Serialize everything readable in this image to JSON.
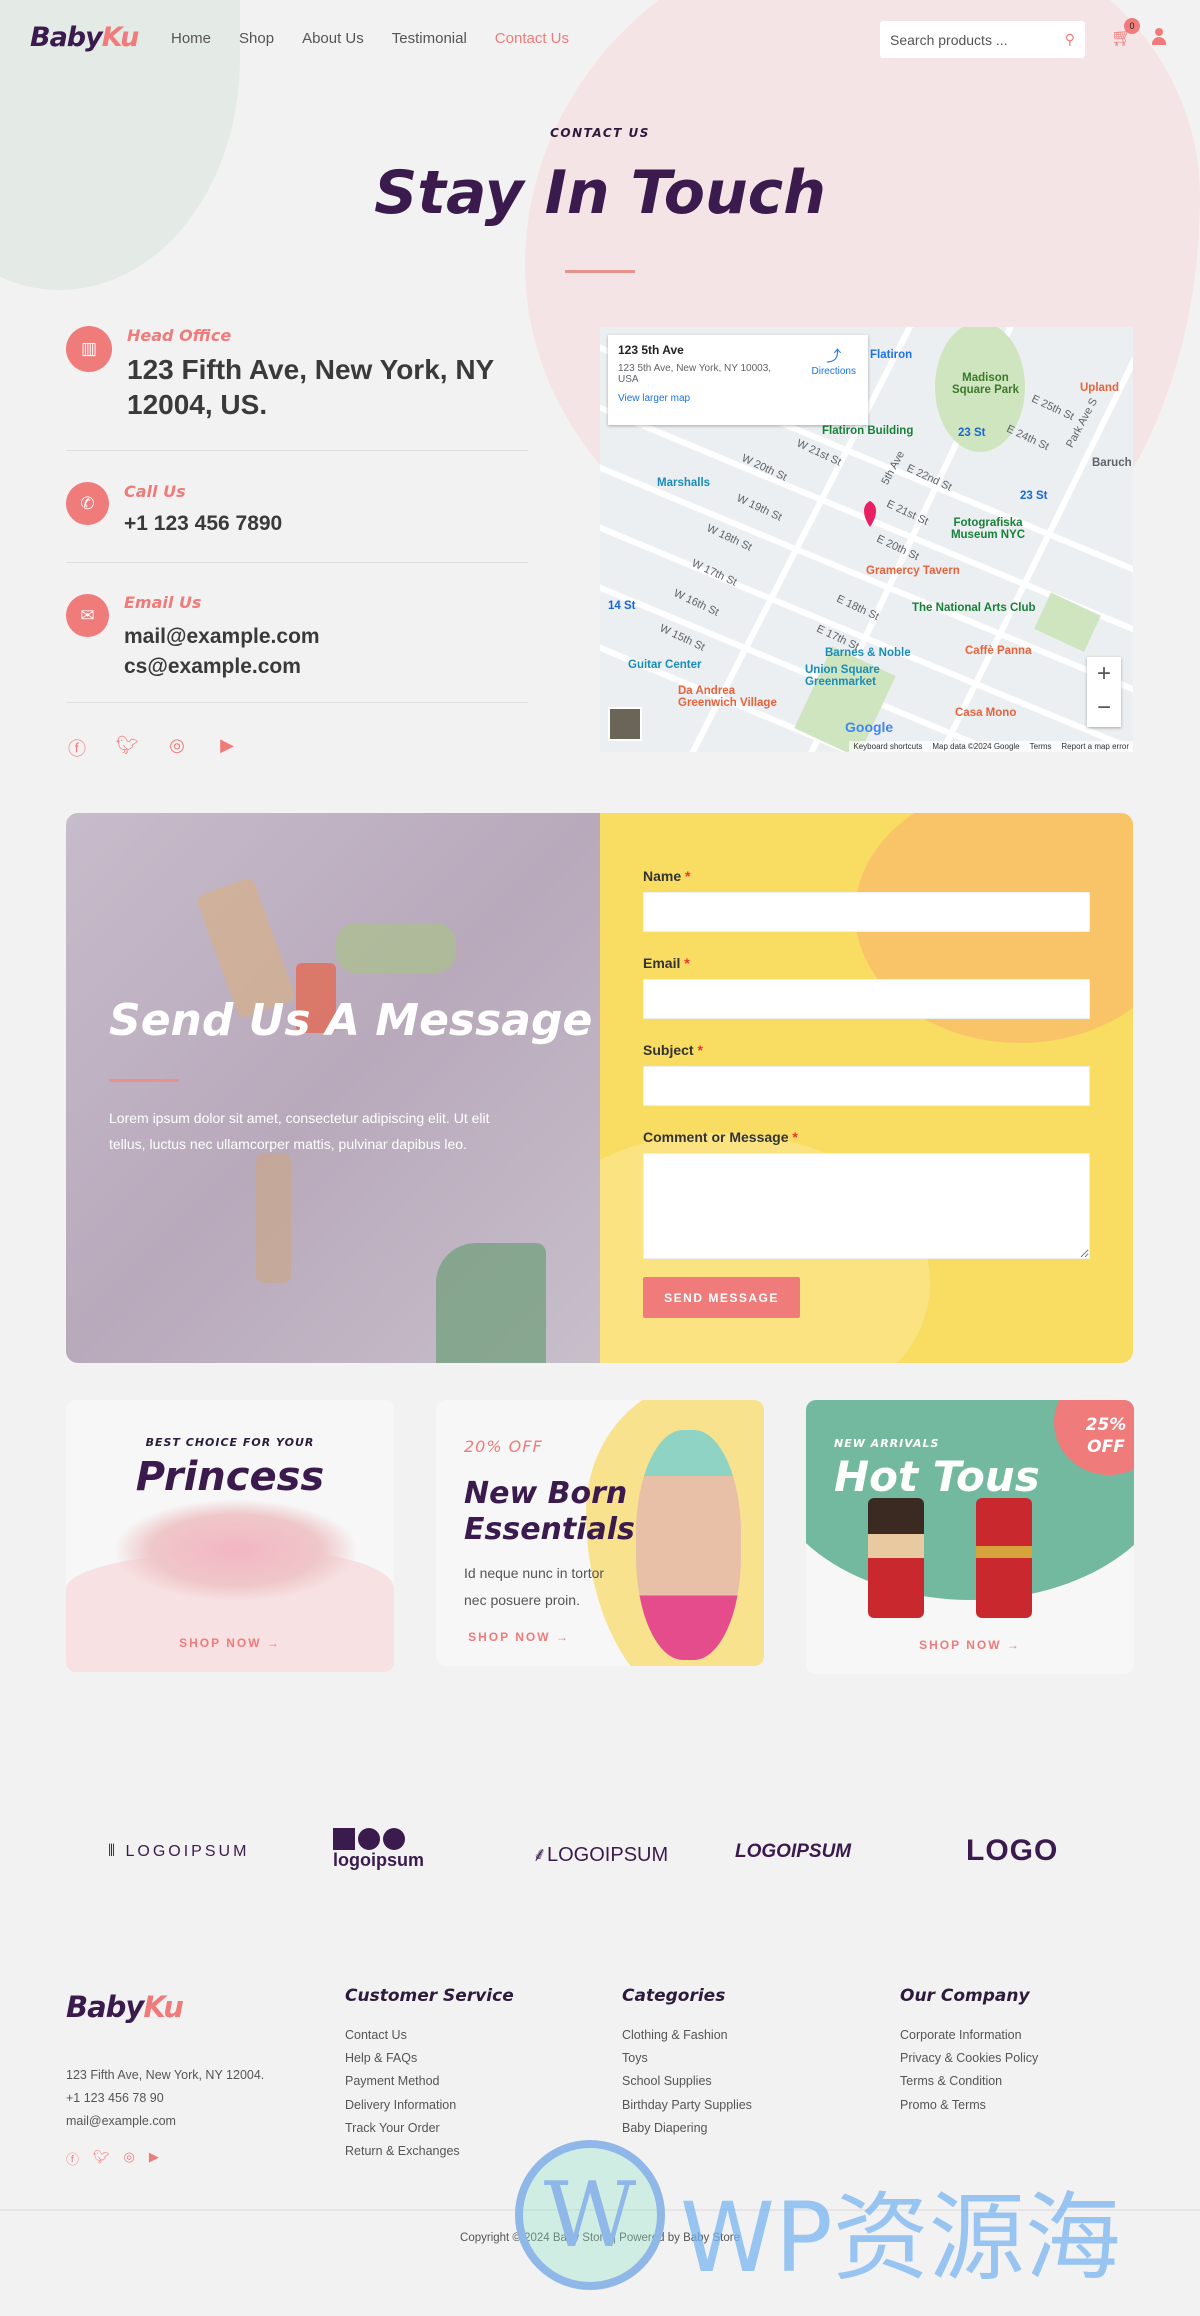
{
  "header": {
    "logo_a": "Baby",
    "logo_b": "Ku",
    "nav": [
      {
        "label": "Home"
      },
      {
        "label": "Shop"
      },
      {
        "label": "About Us"
      },
      {
        "label": "Testimonial"
      },
      {
        "label": "Contact Us",
        "active": true
      }
    ],
    "search_placeholder": "Search products ...",
    "cart_count": "0"
  },
  "hero": {
    "eyebrow": "CONTACT US",
    "title": "Stay In Touch"
  },
  "info": [
    {
      "icon": "building-icon",
      "label": "Head Office",
      "lines": [
        "123 Fifth Ave, New York, NY",
        "12004, US."
      ]
    },
    {
      "icon": "phone-icon",
      "label": "Call Us",
      "lines": [
        "+1 123 456 7890"
      ]
    },
    {
      "icon": "envelope-icon",
      "label": "Email Us",
      "lines": [
        "mail@example.com",
        "cs@example.com"
      ]
    }
  ],
  "socials": [
    "facebook-icon",
    "twitter-icon",
    "instagram-icon",
    "youtube-icon"
  ],
  "map": {
    "place": "123 5th Ave",
    "address": "123 5th Ave, New York, NY 10003, USA",
    "directions": "Directions",
    "larger": "View larger map",
    "pois": [
      {
        "t": "Flatiron",
        "c": "#1a73e8"
      },
      {
        "t": "Madison Square Park",
        "c": "#3c7a2b"
      },
      {
        "t": "Upland",
        "c": "#e8623c"
      },
      {
        "t": "Flatiron Building",
        "c": "#188038"
      },
      {
        "t": "23 St",
        "c": "#1967d2"
      },
      {
        "t": "Marshalls",
        "c": "#1a8cb8"
      },
      {
        "t": "23 St",
        "c": "#1967d2"
      },
      {
        "t": "Fotografiska Museum NYC",
        "c": "#188038"
      },
      {
        "t": "Gramercy Tavern",
        "c": "#e8623c"
      },
      {
        "t": "The National Arts Club",
        "c": "#188038"
      },
      {
        "t": "14 St",
        "c": "#1967d2"
      },
      {
        "t": "Barnes & Noble",
        "c": "#1a8cb8"
      },
      {
        "t": "Guitar Center",
        "c": "#1a8cb8"
      },
      {
        "t": "Union Square Greenmarket",
        "c": "#1a8cb8"
      },
      {
        "t": "Caffè Panna",
        "c": "#e8623c"
      },
      {
        "t": "Da Andrea Greenwich Village",
        "c": "#e8623c"
      },
      {
        "t": "Casa Mono",
        "c": "#e8623c"
      },
      {
        "t": "Baruch",
        "c": "#5f6368"
      }
    ],
    "streets": [
      "W 21st St",
      "W 20th St",
      "W 19th St",
      "W 18th St",
      "W 17th St",
      "W 16th St",
      "W 15th St",
      "E 22nd St",
      "E 21st St",
      "E 20th St",
      "E 18th St",
      "E 17th St",
      "E 25th St",
      "E 24th St",
      "5th Ave",
      "Park Ave S"
    ],
    "footer": [
      "Keyboard shortcuts",
      "Map data ©2024 Google",
      "Terms",
      "Report a map error"
    ],
    "google": "Google",
    "zoom_in": "+",
    "zoom_out": "−"
  },
  "form": {
    "heading": "Send Us A Message",
    "text": "Lorem ipsum dolor sit amet, consectetur adipiscing elit. Ut elit tellus, luctus nec ullamcorper mattis, pulvinar dapibus leo.",
    "fields": [
      {
        "label": "Name"
      },
      {
        "label": "Email"
      },
      {
        "label": "Subject"
      },
      {
        "label": "Comment or Message"
      }
    ],
    "req": "*",
    "submit": "SEND MESSAGE"
  },
  "cards": [
    {
      "eyebrow": "BEST CHOICE FOR YOUR",
      "title": "Princess",
      "cta": "SHOP NOW →"
    },
    {
      "eyebrow": "20% OFF",
      "title1": "New Born",
      "title2": "Essentials",
      "text1": "Id neque nunc in tortor",
      "text2": "nec posuere proin.",
      "cta": "SHOP NOW →"
    },
    {
      "eyebrow": "NEW ARRIVALS",
      "title": "Hot Tous",
      "badge1": "25%",
      "badge2": "OFF",
      "cta": "SHOP NOW →"
    }
  ],
  "logos": [
    "LOGOIPSUM",
    "logoipsum",
    "LOGOIPSUM",
    "LOGOIPSUM",
    "LOGO"
  ],
  "footer": {
    "address": "123 Fifth Ave, New York, NY 12004.",
    "phone": "+1 123 456 78 90",
    "email": "mail@example.com",
    "cols": [
      {
        "title": "Customer Service",
        "links": [
          "Contact Us",
          "Help & FAQs",
          "Payment Method",
          "Delivery Information",
          "Track Your Order",
          "Return & Exchanges"
        ]
      },
      {
        "title": "Categories",
        "links": [
          "Clothing & Fashion",
          "Toys",
          "School Supplies",
          "Birthday Party Supplies",
          "Baby Diapering"
        ]
      },
      {
        "title": "Our Company",
        "links": [
          "Corporate Information",
          "Privacy & Cookies Policy",
          "Terms & Condition",
          "Promo & Terms"
        ]
      }
    ],
    "copyright": "Copyright © 2024 Baby Store | Powered by Baby Store",
    "watermark": "WP资源海"
  },
  "colors": {
    "accent": "#f07b7b",
    "brand": "#3b1b4d",
    "form_bg": "#f9dc62",
    "card_green": "#72b9a0"
  }
}
